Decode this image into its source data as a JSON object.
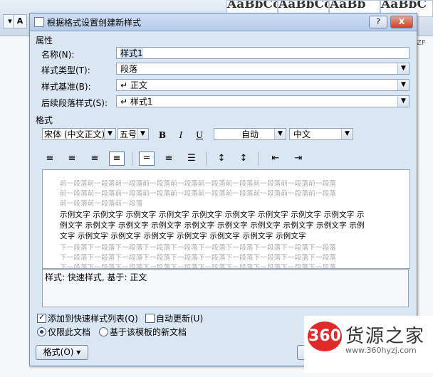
{
  "background": {
    "ribbon_button_a": "A",
    "style_thumbs": [
      "AaBbCcDd",
      "AaBbCcDd",
      "AaBb",
      "AaBbC"
    ],
    "side_text": "ZF"
  },
  "dialog": {
    "title": "根据格式设置创建新样式",
    "help_label": "?",
    "close_label": "X",
    "properties_section": "属性",
    "name_label": "名称(N):",
    "name_value": "样式1",
    "style_type_label": "样式类型(T):",
    "style_type_value": "段落",
    "based_on_label": "样式基准(B):",
    "based_on_value": "↵ 正文",
    "next_style_label": "后续段落样式(S):",
    "next_style_value": "↵ 样式1",
    "format_section": "格式",
    "font_value": "宋体 (中文正文)",
    "size_value": "五号",
    "bold_label": "B",
    "italic_label": "I",
    "underline_label": "U",
    "color_value": "自动",
    "language_value": "中文",
    "preview": {
      "prev_para": [
        "前一段落前一段落前一段落前一段落前一段落前一段落前一段落前一段落前一段落前一段落",
        "前一段落前一段落前一段落前一段落前一段落前一段落前一段落前一段落前一段落前一段落",
        "前一段落前一段落前一段落"
      ],
      "sample": [
        "示例文字 示例文字 示例文字 示例文字 示例文字 示例文字 示例文字 示例文字 示例文字 示",
        "例文字 示例文字 示例文字 示例文字 示例文字 示例文字 示例文字 示例文字 示例文字 示例",
        "文字 示例文字 示例文字 示例文字 示例文字 示例文字 示例文字 示例文字"
      ],
      "next_para": [
        "下一段落下一段落下一段落下一段落下一段落下一段落下一段落下一段落下一段落下一段落",
        "下一段落下一段落下一段落下一段落下一段落下一段落下一段落下一段落下一段落下一段落",
        "下一段落下一段落下一段落下一段落下一段落下一段落下一段落下一段落下一段落下一段落"
      ]
    },
    "description": "样式: 快速样式, 基于: 正文",
    "add_quick_style_label": "添加到快速样式列表(Q)",
    "add_quick_style_checked": true,
    "auto_update_label": "自动更新(U)",
    "auto_update_checked": false,
    "only_this_doc_label": "仅限此文档",
    "new_docs_label": "基于该模板的新文档",
    "format_button_label": "格式(O) ▾"
  },
  "watermark": {
    "logo_text": "360",
    "name": "货源之家",
    "url": "www.360hyzj.com",
    "logo_color": "#e02a2a"
  }
}
